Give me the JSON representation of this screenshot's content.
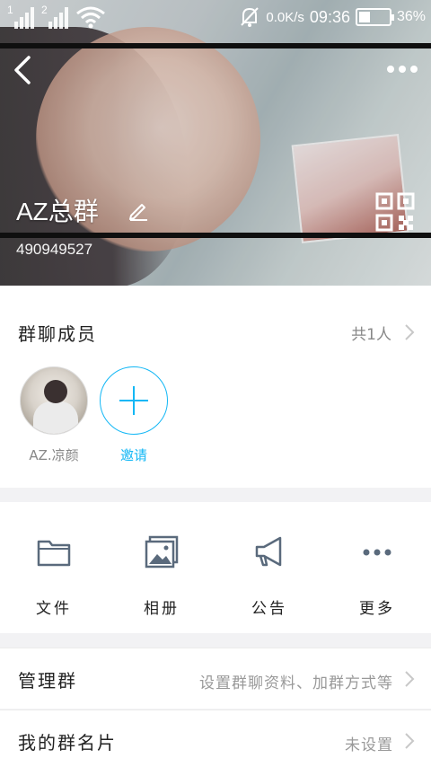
{
  "status_bar": {
    "sim1": "1",
    "sim2": "2",
    "network_speed": "0.0K/s",
    "time": "09:36",
    "battery": "36%",
    "battery_level": 0.36
  },
  "header": {
    "group_name": "AZ总群",
    "group_id": "490949527"
  },
  "members_section": {
    "title": "群聊成员",
    "count": "共1人",
    "members": [
      {
        "name": "AZ.凉颜"
      }
    ],
    "invite_label": "邀请"
  },
  "actions": [
    {
      "label": "文件",
      "icon": "folder-icon"
    },
    {
      "label": "相册",
      "icon": "photo-album-icon"
    },
    {
      "label": "公告",
      "icon": "megaphone-icon"
    },
    {
      "label": "更多",
      "icon": "more-dots-icon"
    }
  ],
  "settings": {
    "manage": {
      "title": "管理群",
      "value": "设置群聊资料、加群方式等"
    },
    "my_card": {
      "title": "我的群名片",
      "value": "未设置"
    }
  },
  "colors": {
    "accent": "#12b7f5",
    "icon_gray": "#5a6a7c"
  }
}
